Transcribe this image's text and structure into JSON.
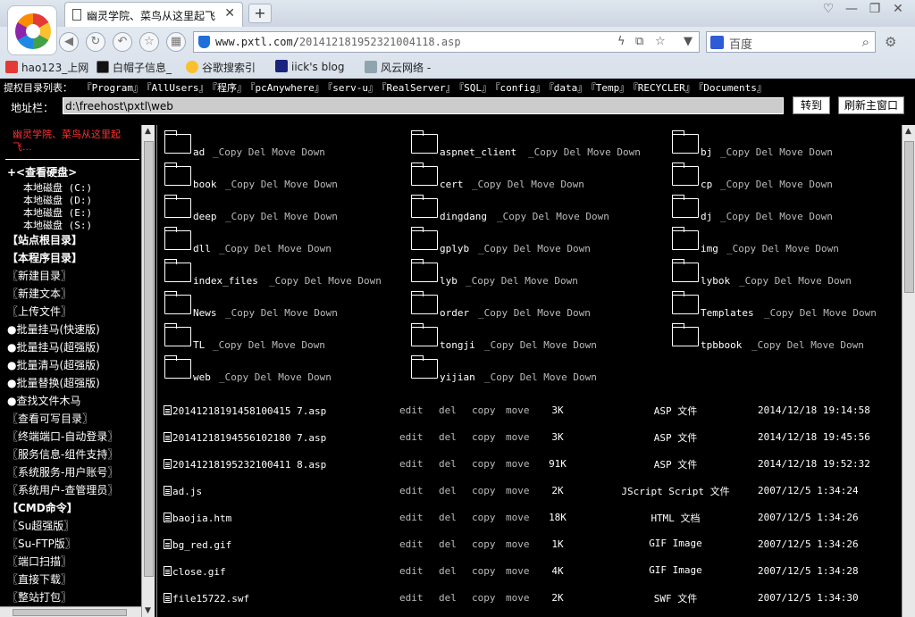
{
  "browser": {
    "tab_title": "幽灵学院、菜鸟从这里起飞",
    "tab_close": "✕",
    "new_tab": "+",
    "window_controls": [
      "♡",
      "—",
      "❐",
      "✕"
    ],
    "url_host": "www.pxtl.com/",
    "url_path": "20141218195232100411 8.asp",
    "url_display_host": "www.pxtl.com/",
    "url_display_path": "20141218195232100411​8.asp",
    "search_placeholder": "百度",
    "favorites": [
      {
        "label": "hao123_上网",
        "color": "#e53935"
      },
      {
        "label": "白帽子信息_",
        "color": "#111111"
      },
      {
        "label": "谷歌搜索引",
        "color": "#fbc02d"
      },
      {
        "label": "iick's blog",
        "color": "#1a237e"
      },
      {
        "label": "风云网络 -",
        "color": "#90a4ae"
      }
    ]
  },
  "page": {
    "dir_list_label": "提权目录列表：",
    "dir_list": [
      "『Program』",
      "『AllUsers』",
      "『程序』",
      "『pcAnywhere』",
      "『serv-u』",
      "『RealServer』",
      "『SQL』",
      "『config』",
      "『data』",
      "『Temp』",
      "『RECYCLER』",
      "『Documents』"
    ],
    "path_label": "地址栏：",
    "path_value": "d:\\freehost\\pxtl\\web",
    "goto_button": "转到",
    "refresh_button": "刷新主窗口"
  },
  "sidebar": {
    "header": "幽灵学院、菜鸟从这里起飞...",
    "disk_toggle": "+<查看硬盘>",
    "disks": [
      "本地磁盘 (C:)",
      "本地磁盘 (D:)",
      "本地磁盘 (E:)",
      "本地磁盘 (S:)"
    ],
    "items": [
      {
        "label": "【站点根目录】",
        "bold": true
      },
      {
        "label": "【本程序目录】",
        "bold": true
      },
      {
        "label": "〖新建目录〗",
        "bold": false
      },
      {
        "label": "〖新建文本〗",
        "bold": false
      },
      {
        "label": "〖上传文件〗",
        "bold": false
      },
      {
        "label": "●批量挂马(快速版)",
        "bold": false
      },
      {
        "label": "●批量挂马(超强版)",
        "bold": false
      },
      {
        "label": "●批量清马(超强版)",
        "bold": false
      },
      {
        "label": "●批量替换(超强版)",
        "bold": false
      },
      {
        "label": "●查找文件木马",
        "bold": false
      },
      {
        "label": "〖查看可写目录〗",
        "bold": false
      },
      {
        "label": "〖终端端口-自动登录〗",
        "bold": false
      },
      {
        "label": "〖服务信息-组件支持〗",
        "bold": false
      },
      {
        "label": "〖系统服务-用户账号〗",
        "bold": false
      },
      {
        "label": "〖系统用户-查管理员〗",
        "bold": false
      },
      {
        "label": "【CMD命令】",
        "bold": true
      },
      {
        "label": "〖Su超强版〗",
        "bold": false
      },
      {
        "label": "〖Su-FTP版〗",
        "bold": false
      },
      {
        "label": "〖端口扫描〗",
        "bold": false
      },
      {
        "label": "〖直接下载〗",
        "bold": false
      },
      {
        "label": "〖整站打包〗",
        "bold": false
      }
    ]
  },
  "folder_actions": [
    "_Copy",
    "Del",
    "Move",
    "Down"
  ],
  "folders": [
    [
      "ad",
      "aspnet_client",
      "bj"
    ],
    [
      "book",
      "cert",
      "cp"
    ],
    [
      "deep",
      "dingdang",
      "dj"
    ],
    [
      "dll",
      "gplyb",
      "img"
    ],
    [
      "index_files",
      "lyb",
      "lybok"
    ],
    [
      "News",
      "order",
      "Templates"
    ],
    [
      "TL",
      "tongji",
      "tpbbook"
    ],
    [
      "web",
      "yijian",
      ""
    ]
  ],
  "file_actions": [
    "edit",
    "del",
    "copy",
    "move"
  ],
  "files": [
    {
      "name": "20141218191458100415 7.asp",
      "size": "3K",
      "type": "ASP 文件",
      "date": "2014/12/18 19:14:58"
    },
    {
      "name": "20141218194556102180 7.asp",
      "size": "3K",
      "type": "ASP 文件",
      "date": "2014/12/18 19:45:56"
    },
    {
      "name": "20141218195232100411 8.asp",
      "size": "91K",
      "type": "ASP 文件",
      "date": "2014/12/18 19:52:32"
    },
    {
      "name": "ad.js",
      "size": "2K",
      "type": "JScript Script 文件",
      "date": "2007/12/5 1:34:24"
    },
    {
      "name": "baojia.htm",
      "size": "18K",
      "type": "HTML 文档",
      "date": "2007/12/5 1:34:26"
    },
    {
      "name": "bg_red.gif",
      "size": "1K",
      "type": "GIF Image",
      "date": "2007/12/5 1:34:26"
    },
    {
      "name": "close.gif",
      "size": "4K",
      "type": "GIF Image",
      "date": "2007/12/5 1:34:28"
    },
    {
      "name": "file15722.swf",
      "size": "2K",
      "type": "SWF 文件",
      "date": "2007/12/5 1:34:30"
    }
  ]
}
